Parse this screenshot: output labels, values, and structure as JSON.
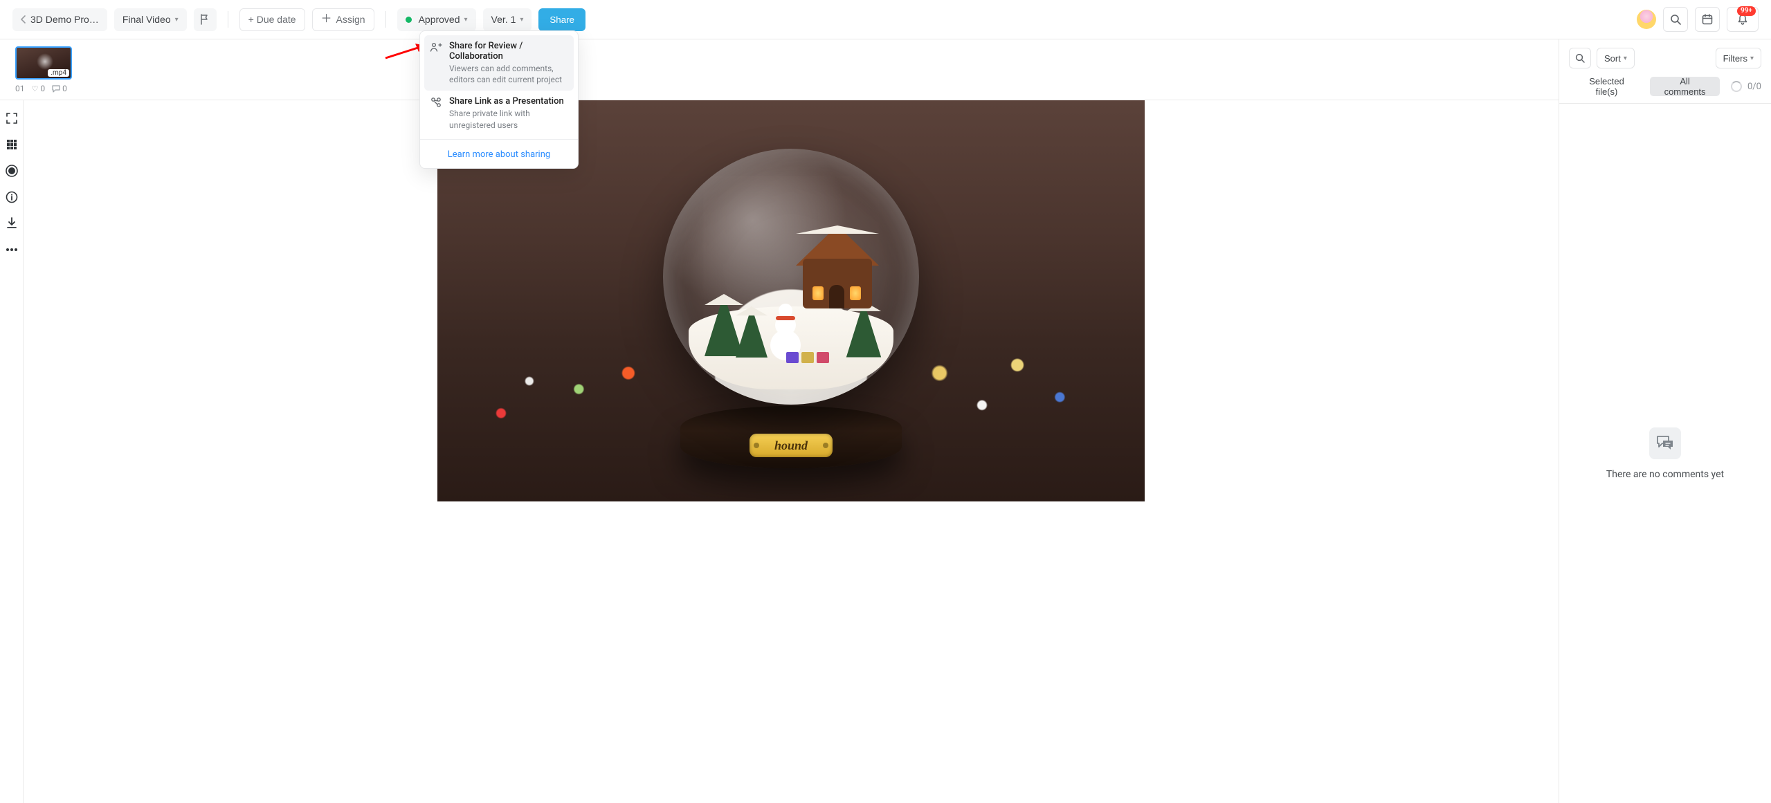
{
  "topbar": {
    "project_label": "3D Demo Pro…",
    "file_label": "Final Video",
    "due_date_label": "+ Due date",
    "assign_label": "Assign",
    "status_label": "Approved",
    "version_label": "Ver. 1",
    "share_label": "Share",
    "notifications_badge": "99+"
  },
  "share_menu": {
    "items": [
      {
        "title": "Share for Review / Collaboration",
        "subtitle": "Viewers can add comments, editors can edit current project"
      },
      {
        "title": "Share Link as a Presentation",
        "subtitle": "Share private link with unregistered users"
      }
    ],
    "learn_more": "Learn more about sharing"
  },
  "thumb": {
    "index": "01",
    "ext": ".mp4",
    "likes": "0",
    "comments": "0"
  },
  "media": {
    "plate_text": "hound"
  },
  "right": {
    "sort_label": "Sort",
    "filters_label": "Filters",
    "tab_selected": "Selected file(s)",
    "tab_all": "All comments",
    "count": "0/0",
    "empty_text": "There are no comments yet"
  }
}
